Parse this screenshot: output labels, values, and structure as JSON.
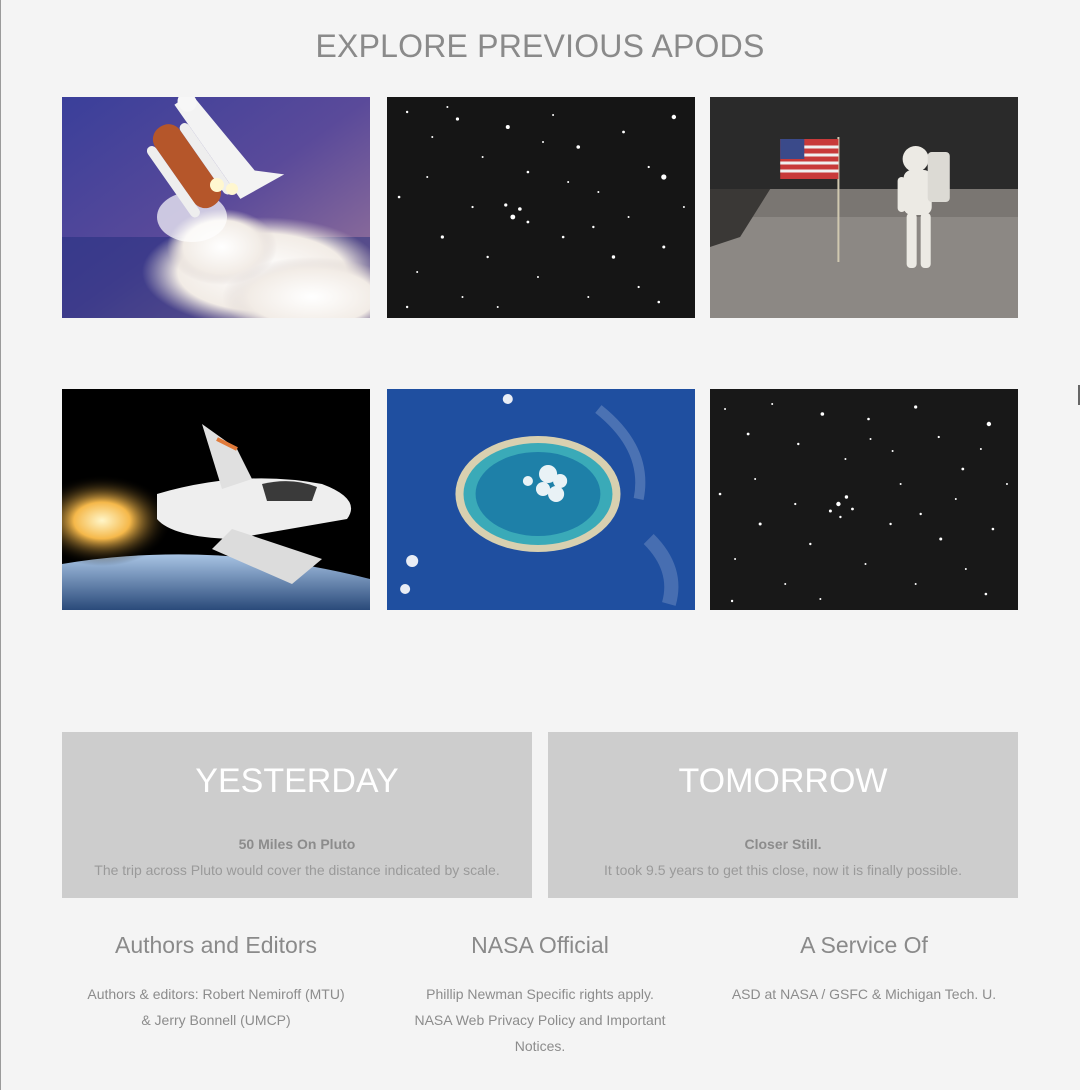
{
  "section": {
    "title": "EXPLORE PREVIOUS APODS"
  },
  "gallery": [
    {
      "subject": "space-shuttle-launch"
    },
    {
      "subject": "star-field"
    },
    {
      "subject": "astronaut-flag-moon"
    },
    {
      "subject": "spaceplane-over-earth"
    },
    {
      "subject": "atoll-from-orbit"
    },
    {
      "subject": "star-cluster"
    }
  ],
  "nav": {
    "yesterday": {
      "title": "YESTERDAY",
      "subtitle": "50 Miles On Pluto",
      "description": "The trip across Pluto would cover the distance indicated by scale."
    },
    "tomorrow": {
      "title": "TOMORROW",
      "subtitle": "Closer Still.",
      "description": "It took 9.5 years to get this close, now it is finally possible."
    }
  },
  "footer": {
    "authors": {
      "heading": "Authors and Editors",
      "line1": "Authors & editors: Robert Nemiroff (MTU)",
      "line2": "& Jerry Bonnell (UMCP)"
    },
    "nasa": {
      "heading": "NASA Official",
      "line1": "Phillip Newman Specific rights apply.",
      "line2": "NASA Web Privacy Policy and Important",
      "line3": "Notices."
    },
    "service": {
      "heading": "A Service Of",
      "line1": "ASD at NASA / GSFC & Michigan Tech. U."
    }
  },
  "colors": {
    "background": "#f4f4f4",
    "card": "#cdcdcd",
    "text": "#8a8a8a"
  }
}
